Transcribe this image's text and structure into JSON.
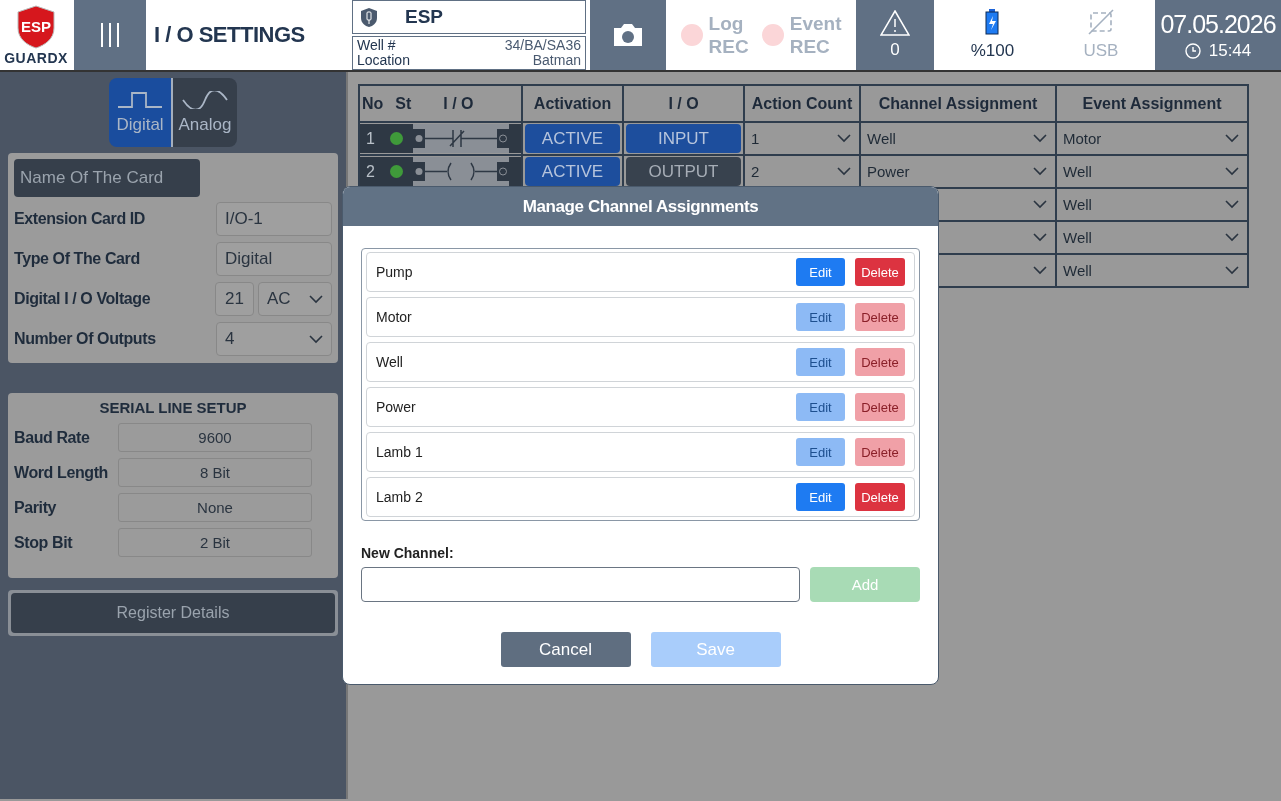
{
  "header": {
    "logo": {
      "top": "ESP",
      "bottom": "GUARDX"
    },
    "title": "I / O SETTINGS",
    "device": {
      "name": "ESP",
      "well_label": "Well #",
      "well": "34/BA/SA36",
      "location_label": "Location",
      "location": "Batman"
    },
    "recorders": [
      {
        "line_1": "Log",
        "line_2": "REC",
        "recording": false
      },
      {
        "line_1": "Event",
        "line_2": "REC",
        "recording": false
      }
    ],
    "alarm_count": "0",
    "battery": "%100",
    "usb": {
      "label": "USB",
      "connected": false
    },
    "date": "07.05.2026",
    "time": "15:44"
  },
  "card": {
    "tabs": [
      {
        "label": "Digital",
        "selected": true,
        "kind": "square"
      },
      {
        "label": "Analog",
        "selected": false,
        "kind": "sine"
      }
    ],
    "name_field": {
      "placeholder": "Name Of The Card"
    },
    "fields": [
      {
        "label": "Extension Card ID",
        "kind": "text",
        "value": "I/O-1"
      },
      {
        "label": "Type Of The Card",
        "kind": "text",
        "value": "Digital"
      },
      {
        "label": "Digital I / O Voltage",
        "kind": "voltage",
        "value": "21",
        "unit": "AC"
      },
      {
        "label": "Number Of Outputs",
        "kind": "select",
        "value": "4"
      }
    ]
  },
  "serial": {
    "title": "SERIAL LINE SETUP",
    "fields": [
      {
        "label": "Baud Rate",
        "value": "9600"
      },
      {
        "label": "Word Length",
        "value": "8 Bit"
      },
      {
        "label": "Parity",
        "value": "None"
      },
      {
        "label": "Stop Bit",
        "value": "2 Bit"
      }
    ]
  },
  "register_button": "Register Details",
  "table": {
    "columns": [
      "No",
      "St",
      "I / O",
      "Activation",
      "I / O",
      "Action Count",
      "Channel Assignment",
      "Event Assignment"
    ],
    "rows": [
      {
        "no": "1",
        "on": true,
        "kind": "nc-contact",
        "activation": "ACTIVE",
        "io": {
          "label": "INPUT",
          "selected": true
        },
        "action_count": "1",
        "channel": "Well",
        "event": "Motor"
      },
      {
        "no": "2",
        "on": true,
        "kind": "coil",
        "activation": "ACTIVE",
        "io": {
          "label": "OUTPUT",
          "selected": false
        },
        "action_count": "2",
        "channel": "Power",
        "event": "Well"
      },
      {
        "event": "Well"
      },
      {
        "event": "Well"
      },
      {
        "event": "Well"
      }
    ]
  },
  "dialog": {
    "title": "Manage Channel Assignments",
    "channels": [
      {
        "name": "Pump",
        "edit": "Edit",
        "delete": "Delete",
        "disabled": false
      },
      {
        "name": "Motor",
        "edit": "Edit",
        "delete": "Delete",
        "disabled": true
      },
      {
        "name": "Well",
        "edit": "Edit",
        "delete": "Delete",
        "disabled": true
      },
      {
        "name": "Power",
        "edit": "Edit",
        "delete": "Delete",
        "disabled": true
      },
      {
        "name": "Lamb 1",
        "edit": "Edit",
        "delete": "Delete",
        "disabled": true
      },
      {
        "name": "Lamb 2",
        "edit": "Edit",
        "delete": "Delete",
        "disabled": false
      }
    ],
    "new_channel_label": "New Channel:",
    "add": {
      "label": "Add",
      "disabled": true
    },
    "cancel": "Cancel",
    "save": {
      "label": "Save",
      "disabled": true
    }
  }
}
